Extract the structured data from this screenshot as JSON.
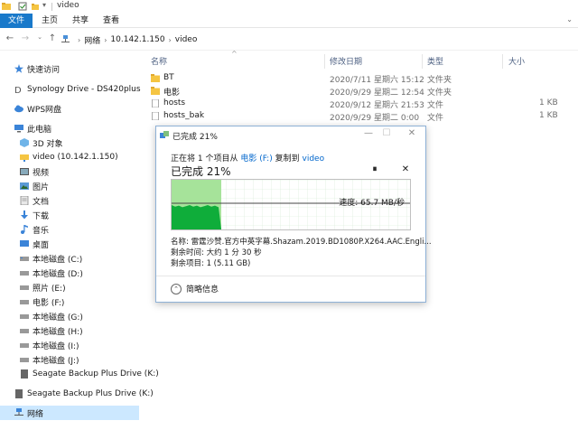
{
  "window": {
    "title": "video"
  },
  "ribbon": {
    "tabs": [
      "文件",
      "主页",
      "共享",
      "查看"
    ]
  },
  "address": {
    "segments": [
      "网络",
      "10.142.1.150",
      "video"
    ]
  },
  "sidebar": {
    "items": [
      {
        "label": "快速访问",
        "icon": "star-icon"
      },
      {
        "label": "Synology Drive - DS420plus",
        "icon": "synology-icon"
      },
      {
        "label": "WPS网盘",
        "icon": "cloud-icon"
      },
      {
        "label": "此电脑",
        "icon": "computer-icon"
      },
      {
        "label": "3D 对象",
        "icon": "cube-icon"
      },
      {
        "label": "video (10.142.1.150)",
        "icon": "network-folder-icon"
      },
      {
        "label": "视频",
        "icon": "video-icon"
      },
      {
        "label": "图片",
        "icon": "picture-icon"
      },
      {
        "label": "文档",
        "icon": "document-icon"
      },
      {
        "label": "下载",
        "icon": "download-icon"
      },
      {
        "label": "音乐",
        "icon": "music-icon"
      },
      {
        "label": "桌面",
        "icon": "desktop-icon"
      },
      {
        "label": "本地磁盘 (C:)",
        "icon": "drive-icon"
      },
      {
        "label": "本地磁盘 (D:)",
        "icon": "drive-icon"
      },
      {
        "label": "照片 (E:)",
        "icon": "drive-icon"
      },
      {
        "label": "电影 (F:)",
        "icon": "drive-icon"
      },
      {
        "label": "本地磁盘 (G:)",
        "icon": "drive-icon"
      },
      {
        "label": "本地磁盘 (H:)",
        "icon": "drive-icon"
      },
      {
        "label": "本地磁盘 (I:)",
        "icon": "drive-icon"
      },
      {
        "label": "本地磁盘 (J:)",
        "icon": "drive-icon"
      },
      {
        "label": "Seagate Backup Plus Drive (K:)",
        "icon": "external-drive-icon"
      },
      {
        "label": "Seagate Backup Plus Drive (K:)",
        "icon": "external-drive-icon"
      },
      {
        "label": "网络",
        "icon": "network-icon"
      }
    ]
  },
  "columns": {
    "name": "名称",
    "date": "修改日期",
    "type": "类型",
    "size": "大小"
  },
  "files": [
    {
      "name": "BT",
      "date": "2020/7/11 星期六 15:12",
      "type": "文件夹",
      "size": "",
      "icon": "folder-icon"
    },
    {
      "name": "电影",
      "date": "2020/9/29 星期二 12:54",
      "type": "文件夹",
      "size": "",
      "icon": "folder-icon"
    },
    {
      "name": "hosts",
      "date": "2020/9/12 星期六 21:53",
      "type": "文件",
      "size": "1 KB",
      "icon": "file-icon"
    },
    {
      "name": "hosts_bak",
      "date": "2020/9/29 星期二 0:00",
      "type": "文件",
      "size": "1 KB",
      "icon": "file-icon"
    }
  ],
  "dialog": {
    "title": "已完成 21%",
    "line_prefix": "正在将 1 个项目从",
    "source": "电影 (F:)",
    "line_mid": "复制到",
    "dest": "video",
    "big_status": "已完成 21%",
    "speed": "速度: 65.7 MB/秒",
    "progress_fraction": 0.21,
    "name_line": "名称: 雷霆沙赞.官方中英字幕.Shazam.2019.BD1080P.X264.AAC.Engli...",
    "time_left": "剩余时间: 大约 1 分 30 秒",
    "items_left": "剩余项目: 1 (5.11 GB)",
    "less_info": "简略信息"
  },
  "colors": {
    "accent": "#1979ca",
    "progress_light": "#a6e39a",
    "progress_dark": "#0fad3a",
    "selection": "#cce8ff"
  }
}
